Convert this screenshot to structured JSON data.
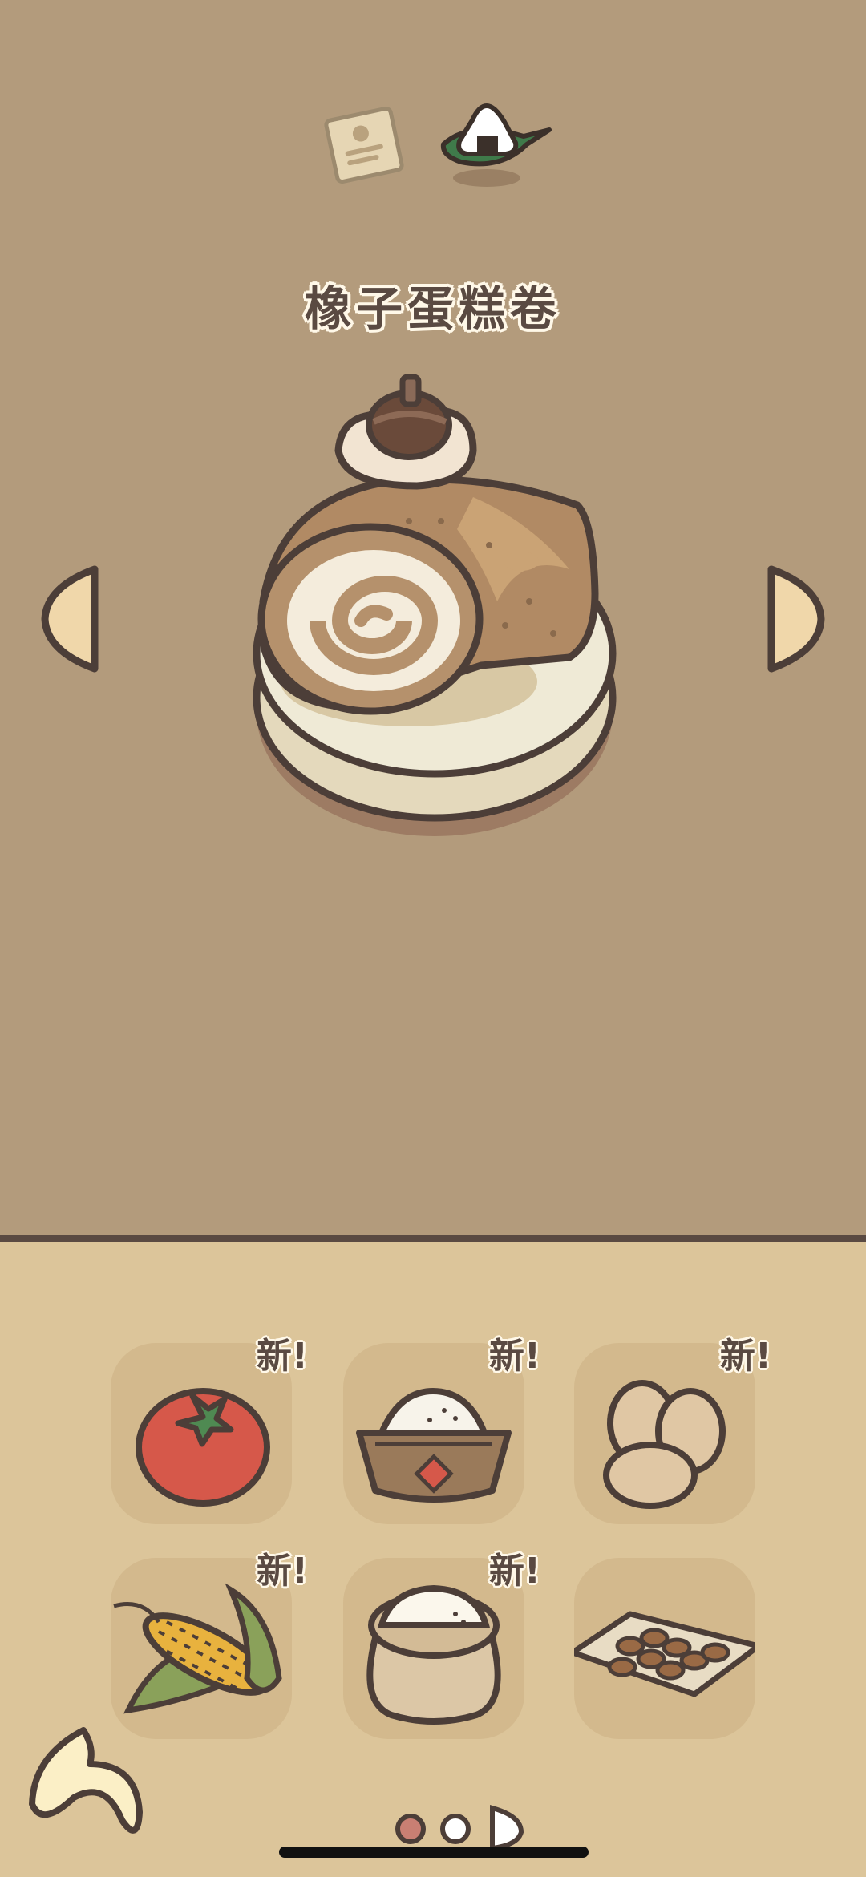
{
  "header": {
    "tabs": [
      {
        "name": "recipe-note-icon",
        "active": false
      },
      {
        "name": "onigiri-leaf-icon",
        "active": true
      }
    ]
  },
  "dish": {
    "title": "橡子蛋糕卷",
    "image": "acorn-cake-roll-on-plate"
  },
  "navigation": {
    "prev_icon": "chevron-left-icon",
    "next_icon": "chevron-right-icon"
  },
  "ingredients": [
    {
      "name": "tomato",
      "badge": "新!"
    },
    {
      "name": "rice-bowl",
      "badge": "新!"
    },
    {
      "name": "eggs",
      "badge": "新!"
    },
    {
      "name": "corn",
      "badge": "新!"
    },
    {
      "name": "flour-sack",
      "badge": "新!"
    },
    {
      "name": "nuts",
      "badge": ""
    }
  ],
  "footer": {
    "back_icon": "back-arrow-icon",
    "page_dots": [
      {
        "state": "current",
        "color": "#c97f73"
      },
      {
        "state": "other",
        "color": "#ffffff"
      },
      {
        "state": "half",
        "color": "#ffffff"
      }
    ]
  },
  "colors": {
    "top_background": "#b39b7c",
    "bottom_background": "#dcc59a",
    "slot_background": "#d3b98d",
    "outline": "#5a4a42"
  }
}
